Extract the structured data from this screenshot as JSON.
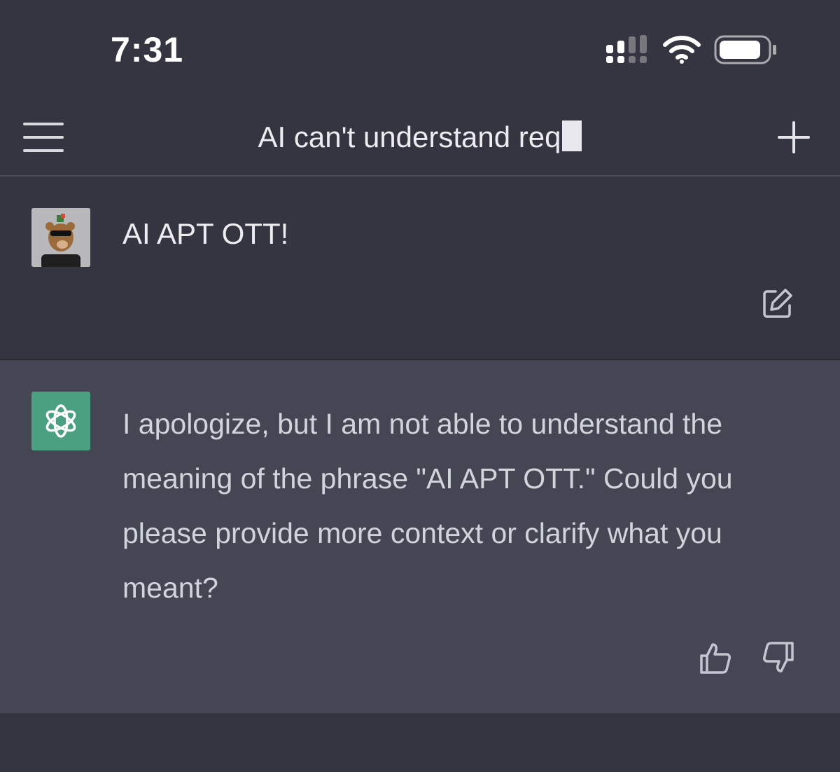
{
  "status_bar": {
    "time": "7:31",
    "icons": [
      "signal-icon",
      "wifi-icon",
      "battery-icon"
    ]
  },
  "nav": {
    "title": "AI can't understand req",
    "menu_icon": "menu-icon",
    "new_chat_icon": "plus-icon"
  },
  "conversation": {
    "user_message": {
      "text": "AI APT OTT!",
      "avatar": "bear-avatar",
      "action_icon": "edit-icon"
    },
    "assistant_message": {
      "text": "I apologize, but I am not able to understand the meaning of the phrase \"AI APT OTT.\" Could you please provide more context or clarify what you meant?",
      "avatar": "openai-logo-icon",
      "feedback_icons": [
        "thumbs-up-icon",
        "thumbs-down-icon"
      ]
    }
  },
  "colors": {
    "background": "#343541",
    "assistant_background": "#444654",
    "logo_green": "#4aa081",
    "text": "#ececf1"
  }
}
